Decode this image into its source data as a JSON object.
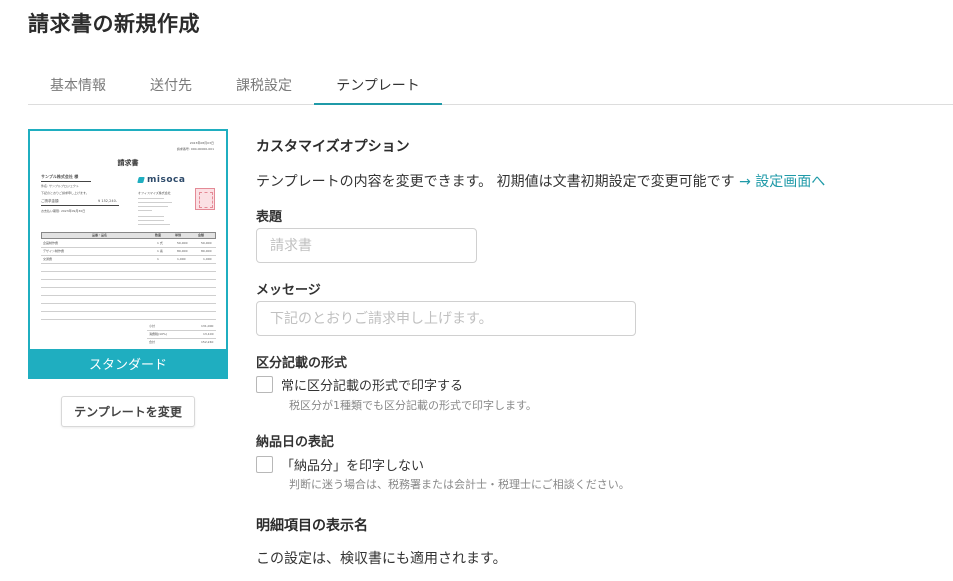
{
  "page": {
    "title": "請求書の新規作成"
  },
  "tabs": [
    {
      "label": "基本情報",
      "active": false
    },
    {
      "label": "送付先",
      "active": false
    },
    {
      "label": "課税設定",
      "active": false
    },
    {
      "label": "テンプレート",
      "active": true
    }
  ],
  "template": {
    "name": "スタンダード",
    "change_button": "テンプレートを変更",
    "preview": {
      "date_line": "2023年08月03日",
      "number_line": "請求番号: 000-00000-001",
      "title": "請求書",
      "client": "サンプル株式会社 様",
      "subject": "件名: サンプルプロジェクト",
      "note": "下記のとおりご請求申し上げます。",
      "amount_label": "ご請求金額",
      "amount_value": "¥ 152,240-",
      "due": "お支払い期限: 2023年09月30日",
      "brand": "misoca",
      "company": "オフィスマイズ株式会社",
      "head_item": "品番・品名",
      "head_qty": "数量",
      "head_price": "単価",
      "head_amount": "金額",
      "rows": [
        {
          "item": "企画制作費",
          "qty": "1 式",
          "price": "50,000",
          "amount": "50,000"
        },
        {
          "item": "デザイン制作費",
          "qty": "1 案",
          "price": "80,000",
          "amount": "80,000"
        },
        {
          "item": "交通費",
          "qty": "1",
          "price": "1,000",
          "amount": "1,000"
        }
      ],
      "subtotal_label": "小計",
      "subtotal_value": "131,000",
      "tax_label": "消費税(10%)",
      "tax_value": "13,100",
      "total_label": "合計",
      "total_value": "152,240"
    }
  },
  "options": {
    "title": "カスタマイズオプション",
    "description": "テンプレートの内容を変更できます。 初期値は文書初期設定で変更可能です",
    "settings_link": "→ 設定画面へ",
    "heading_field": {
      "label": "表題",
      "placeholder": "請求書",
      "value": ""
    },
    "message_field": {
      "label": "メッセージ",
      "placeholder": "下記のとおりご請求申し上げます。",
      "value": ""
    },
    "tax_format": {
      "label": "区分記載の形式",
      "checkbox_label": "常に区分記載の形式で印字する",
      "checked": false,
      "hint": "税区分が1種類でも区分記載の形式で印字します。"
    },
    "delivery_date": {
      "label": "納品日の表記",
      "checkbox_label": "「納品分」を印字しない",
      "checked": false,
      "hint": "判断に迷う場合は、税務署または会計士・税理士にご相談ください。"
    },
    "detail_names": {
      "title": "明細項目の表示名",
      "description": "この設定は、検収書にも適用されます。"
    }
  },
  "colors": {
    "accent": "#1faec0",
    "link": "#1f9aa8"
  }
}
